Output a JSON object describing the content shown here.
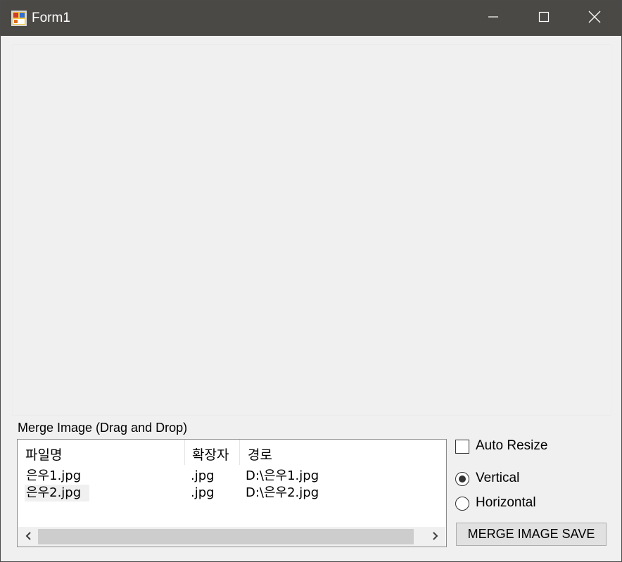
{
  "window": {
    "title": "Form1",
    "icon": "form-app-icon",
    "controls": {
      "minimize_icon": "minimize-icon",
      "maximize_icon": "maximize-icon",
      "close_icon": "close-icon"
    }
  },
  "merge_group": {
    "label": "Merge Image (Drag and Drop)"
  },
  "file_list": {
    "columns": [
      "파일명",
      "확장자",
      "경로"
    ],
    "rows": [
      {
        "name": "은우1.jpg",
        "ext": ".jpg",
        "path": "D:\\은우1.jpg"
      },
      {
        "name": "은우2.jpg",
        "ext": ".jpg",
        "path": "D:\\은우2.jpg"
      }
    ],
    "scroll_left_icon": "chevron-left-icon",
    "scroll_right_icon": "chevron-right-icon"
  },
  "options": {
    "auto_resize": {
      "label": "Auto Resize",
      "checked": false
    },
    "orientation": {
      "selected": "Vertical",
      "vertical_label": "Vertical",
      "horizontal_label": "Horizontal"
    },
    "save_button_label": "MERGE IMAGE SAVE"
  },
  "colors": {
    "titlebar": "#4b4946",
    "window_bg": "#f0f0f0",
    "list_bg": "#ffffff",
    "button_bg": "#e1e1e1"
  }
}
